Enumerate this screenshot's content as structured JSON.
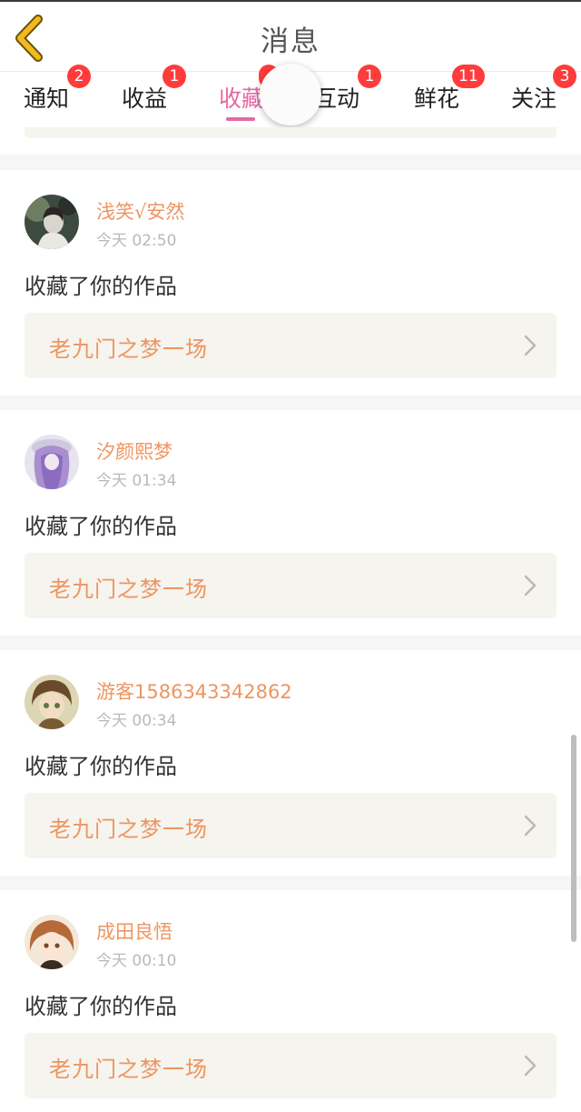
{
  "header": {
    "title": "消息",
    "back_icon": "back-chevron-icon",
    "back_color": "#f2b920"
  },
  "tabs": [
    {
      "label": "通知",
      "badge": "2"
    },
    {
      "label": "收益",
      "badge": "1"
    },
    {
      "label": "收藏",
      "badge": "",
      "active": true
    },
    {
      "label": "互动",
      "badge": "1"
    },
    {
      "label": "鲜花",
      "badge": "11"
    },
    {
      "label": "关注",
      "badge": "3"
    }
  ],
  "colors": {
    "accent": "#e569a3",
    "username": "#ee9561",
    "badge": "#ff3b3b",
    "link_bg": "#f5f4ee"
  },
  "notifications": [
    {
      "username": "浅笑√安然",
      "time": "今天 02:50",
      "action": "收藏了你的作品",
      "work_title": "老九门之梦一场"
    },
    {
      "username": "汐颜熙梦",
      "time": "今天 01:34",
      "action": "收藏了你的作品",
      "work_title": "老九门之梦一场"
    },
    {
      "username": "游客1586343342862",
      "time": "今天 00:34",
      "action": "收藏了你的作品",
      "work_title": "老九门之梦一场"
    },
    {
      "username": "成田良悟",
      "time": "今天 00:10",
      "action": "收藏了你的作品",
      "work_title": "老九门之梦一场"
    }
  ]
}
